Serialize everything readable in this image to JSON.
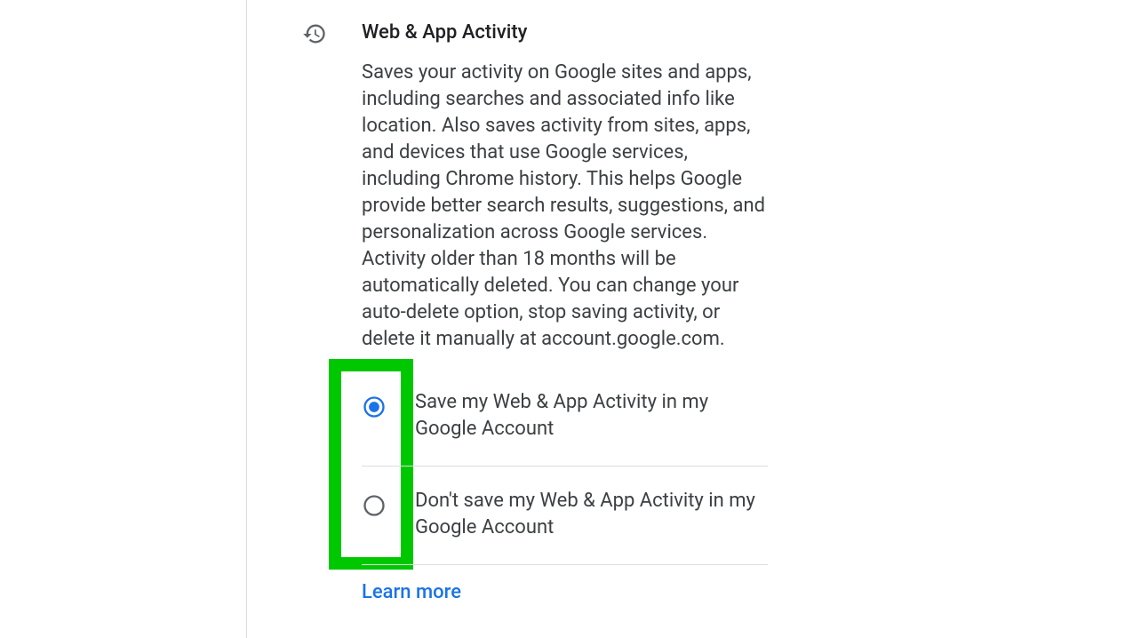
{
  "section": {
    "title": "Web & App Activity",
    "description": "Saves your activity on Google sites and apps, including searches and associated info like location. Also saves activity from sites, apps, and devices that use Google services, including Chrome history. This helps Google provide better search results, suggestions, and personalization across Google services. Activity older than 18 months will be automatically deleted. You can change your auto-delete option, stop saving activity, or delete it manually at account.google.com.",
    "options": [
      {
        "label": "Save my Web & App Activity in my Google Account",
        "selected": true
      },
      {
        "label": "Don't save my Web & App Activity in my Google Account",
        "selected": false
      }
    ],
    "learn_more": "Learn more"
  }
}
